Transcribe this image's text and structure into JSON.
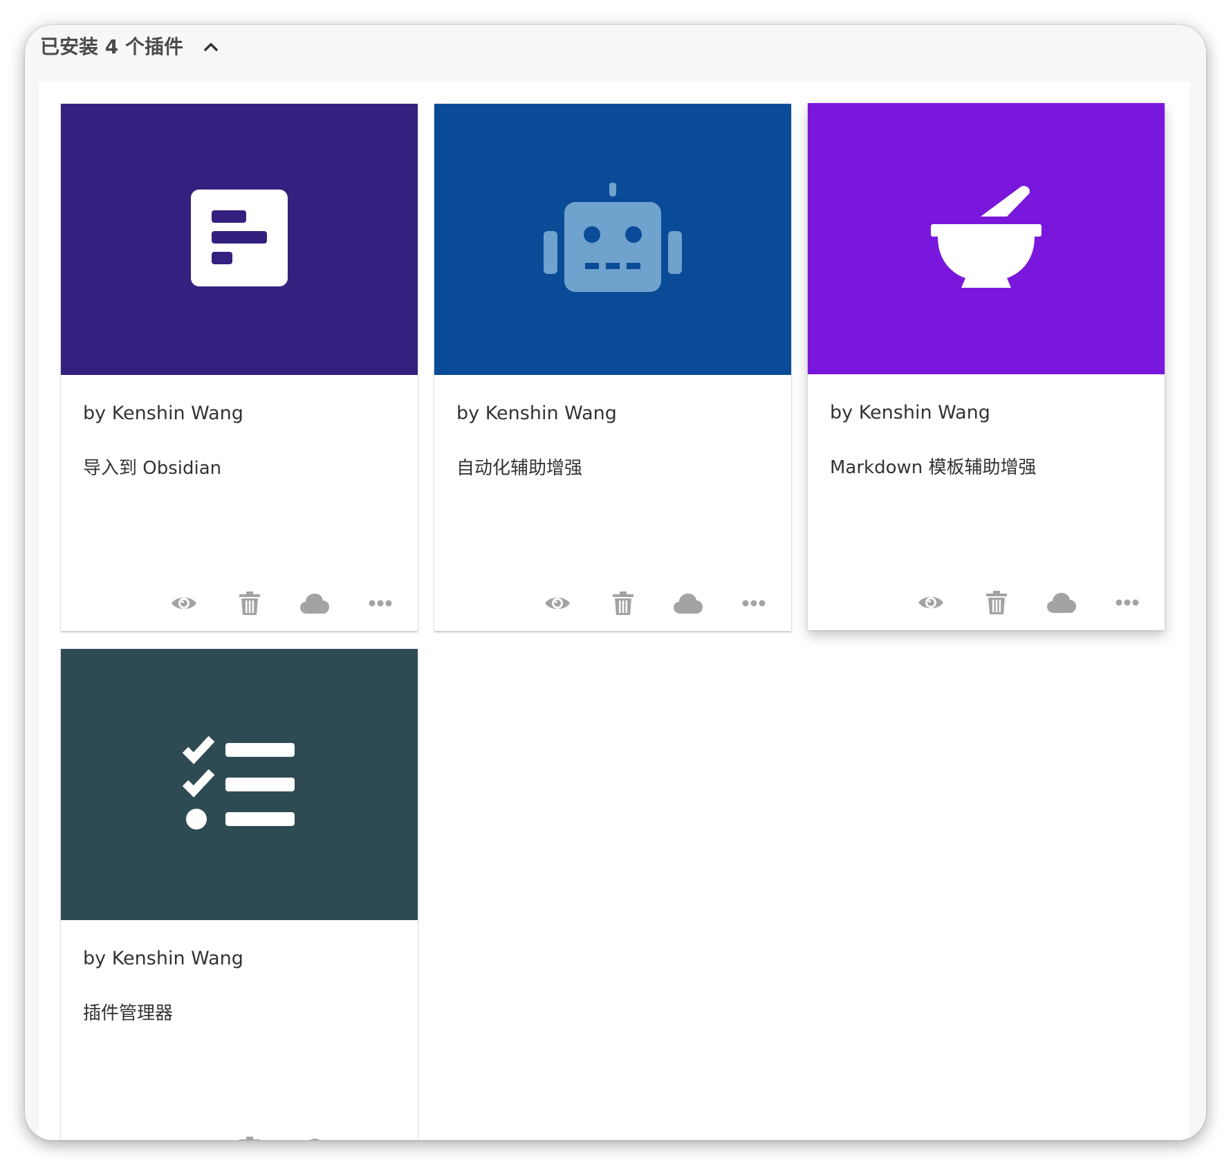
{
  "header": {
    "title": "已安装 4 个插件",
    "collapse_icon": "chevron-up-icon"
  },
  "colors": {
    "card1_banner": "#36207f",
    "card2_banner": "#0a4b97",
    "card3_banner": "#7a17dc",
    "card4_banner": "#2e4b54",
    "action_icon": "#a3a3a3"
  },
  "plugins": [
    {
      "author": "by Kenshin Wang",
      "description": "导入到 Obsidian",
      "icon": "obsidian-import-icon"
    },
    {
      "author": "by Kenshin Wang",
      "description": "自动化辅助增强",
      "icon": "robot-icon"
    },
    {
      "author": "by Kenshin Wang",
      "description": "Markdown 模板辅助增强",
      "icon": "mortar-pestle-icon"
    },
    {
      "author": "by Kenshin Wang",
      "description": "插件管理器",
      "icon": "checklist-icon"
    }
  ],
  "actions": [
    "eye-icon",
    "trash-icon",
    "cloud-icon",
    "more-icon"
  ]
}
